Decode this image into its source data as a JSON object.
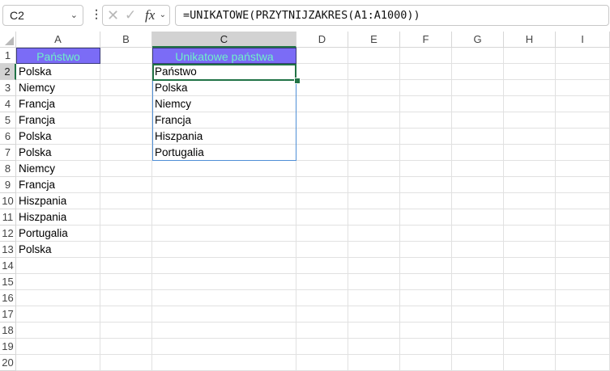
{
  "formula_bar": {
    "name_box": "C2",
    "formula": "=UNIKATOWE(PRZYTNIJZAKRES(A1:A1000))",
    "fx_label": "fx"
  },
  "columns": [
    "A",
    "B",
    "C",
    "D",
    "E",
    "F",
    "G",
    "H",
    "I"
  ],
  "rows": [
    "1",
    "2",
    "3",
    "4",
    "5",
    "6",
    "7",
    "8",
    "9",
    "10",
    "11",
    "12",
    "13",
    "14",
    "15",
    "16",
    "17",
    "18",
    "19",
    "20"
  ],
  "active_cell": {
    "column": "C",
    "row": "2"
  },
  "cells": {
    "A1": "Państwo",
    "A2": "Polska",
    "A3": "Niemcy",
    "A4": "Francja",
    "A5": "Francja",
    "A6": "Polska",
    "A7": "Polska",
    "A8": "Niemcy",
    "A9": "Francja",
    "A10": "Hiszpania",
    "A11": "Hiszpania",
    "A12": "Portugalia",
    "A13": "Polska",
    "C1": "Unikatowe państwa",
    "C2": "Państwo",
    "C3": "Polska",
    "C4": "Niemcy",
    "C5": "Francja",
    "C6": "Hiszpania",
    "C7": "Portugalia"
  },
  "colors": {
    "header_fill": "#7b6cf6",
    "header_text": "#6ef0c8",
    "selection": "#217346",
    "spill_border": "#4f8fd6"
  }
}
